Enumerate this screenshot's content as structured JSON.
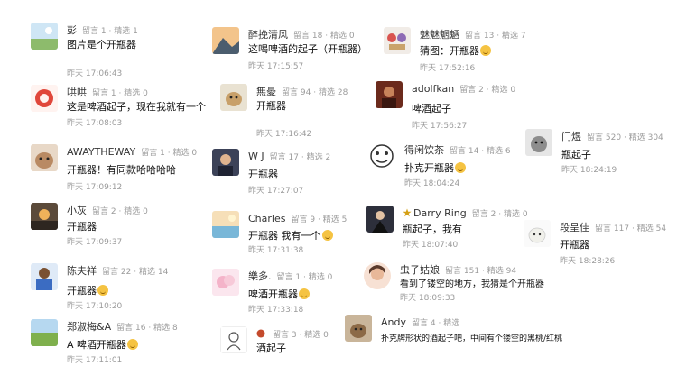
{
  "stat_sep": "·",
  "comments": [
    {
      "id": "c1",
      "nick": "彭",
      "msg_label": "留言",
      "msg_count": "1",
      "pick_label": "精选",
      "pick_count": "1",
      "text": "图片是个开瓶器",
      "emoji": "",
      "time": "昨天 17:06:43",
      "avatar": "landscape"
    },
    {
      "id": "c2",
      "nick": "哄哄",
      "msg_label": "留言",
      "msg_count": "1",
      "pick_label": "精选",
      "pick_count": "0",
      "text": "这是啤酒起子，现在我就有一个",
      "emoji": "",
      "time": "昨天 17:08:03",
      "avatar": "red-circle"
    },
    {
      "id": "c3",
      "nick": "AWAYTHEWAY",
      "msg_label": "留言",
      "msg_count": "1",
      "pick_label": "精选",
      "pick_count": "0",
      "text": "开瓶器！有同款哈哈哈哈",
      "emoji": "",
      "time": "昨天 17:09:12",
      "avatar": "cat"
    },
    {
      "id": "c4",
      "nick": "小灰",
      "msg_label": "留言",
      "msg_count": "2",
      "pick_label": "精选",
      "pick_count": "0",
      "text": "开瓶器",
      "emoji": "",
      "time": "昨天 17:09:37",
      "avatar": "sunset"
    },
    {
      "id": "c5",
      "nick": "陈夫祥",
      "msg_label": "留言",
      "msg_count": "22",
      "pick_label": "精选",
      "pick_count": "14",
      "text": "开瓶器",
      "emoji": "smile",
      "time": "昨天 17:10:20",
      "avatar": "person-blue"
    },
    {
      "id": "c6",
      "nick": "郑淑梅&A",
      "msg_label": "留言",
      "msg_count": "16",
      "pick_label": "精选",
      "pick_count": "8",
      "text": "A 啤酒开瓶器",
      "emoji": "smile",
      "time": "昨天 17:11:01",
      "avatar": "field"
    },
    {
      "id": "c7",
      "nick": "醉挽清风",
      "msg_label": "留言",
      "msg_count": "18",
      "pick_label": "精选",
      "pick_count": "0",
      "text": "这喝啤酒的起子（开瓶器）",
      "emoji": "",
      "time": "昨天 17:15:57",
      "avatar": "mountain"
    },
    {
      "id": "c8",
      "nick": "無憂",
      "msg_label": "留言",
      "msg_count": "94",
      "pick_label": "精选",
      "pick_count": "28",
      "text": "开瓶器",
      "emoji": "",
      "time": "昨天 17:16:42",
      "avatar": "dog"
    },
    {
      "id": "c9",
      "nick": "W J",
      "msg_label": "留言",
      "msg_count": "17",
      "pick_label": "精选",
      "pick_count": "2",
      "text": "开瓶器",
      "emoji": "",
      "time": "昨天 17:27:07",
      "avatar": "boy"
    },
    {
      "id": "c10",
      "nick": "Charles",
      "msg_label": "留言",
      "msg_count": "9",
      "pick_label": "精选",
      "pick_count": "5",
      "text": "开瓶器 我有一个",
      "emoji": "smile",
      "time": "昨天 17:31:38",
      "avatar": "beach"
    },
    {
      "id": "c11",
      "nick": "樂多.",
      "msg_label": "留言",
      "msg_count": "1",
      "pick_label": "精选",
      "pick_count": "0",
      "text": "啤酒开瓶器",
      "emoji": "smile",
      "time": "昨天 17:33:18",
      "avatar": "pink"
    },
    {
      "id": "c12",
      "nick": "",
      "msg_label": "留言",
      "msg_count": "3",
      "pick_label": "精选",
      "pick_count": "0",
      "text": "酒起子",
      "emoji": "",
      "time": "",
      "avatar": "sketch"
    },
    {
      "id": "c13",
      "nick": "魅魅魍魉",
      "msg_label": "留言",
      "msg_count": "13",
      "pick_label": "精选",
      "pick_count": "7",
      "text": "猜图：开瓶器",
      "emoji": "smile",
      "time": "昨天 17:52:16",
      "avatar": "toys"
    },
    {
      "id": "c14",
      "nick": "adolfkan",
      "msg_label": "留言",
      "msg_count": "2",
      "pick_label": "精选",
      "pick_count": "0",
      "text": "啤酒起子",
      "emoji": "",
      "time": "昨天 17:56:27",
      "avatar": "dark-red"
    },
    {
      "id": "c15",
      "nick": "得闲饮茶",
      "msg_label": "留言",
      "msg_count": "14",
      "pick_label": "精选",
      "pick_count": "6",
      "text": "扑克开瓶器",
      "emoji": "smile",
      "time": "昨天 18:04:24",
      "avatar": "meme"
    },
    {
      "id": "c16",
      "nick": "Darry Ring",
      "msg_label": "留言",
      "msg_count": "2",
      "pick_label": "精选",
      "pick_count": "0",
      "text": "瓶起子，我有",
      "emoji": "",
      "time": "昨天 18:07:40",
      "avatar": "suit"
    },
    {
      "id": "c17",
      "nick": "虫子姑娘",
      "msg_label": "留言",
      "msg_count": "151",
      "pick_label": "精选",
      "pick_count": "94",
      "text": "看到了镂空的地方，我猜是个开瓶器",
      "emoji": "",
      "time": "昨天 18:09:33",
      "avatar": "girl"
    },
    {
      "id": "c18",
      "nick": "Andy",
      "msg_label": "留言",
      "msg_count": "4",
      "pick_label": "精选",
      "pick_count": "",
      "text": "扑克牌形状的酒起子吧，中间有个镂空的黑桃/红桃",
      "emoji": "",
      "time": "",
      "avatar": "dog-small"
    },
    {
      "id": "c19",
      "nick": "门煜",
      "msg_label": "留言",
      "msg_count": "520",
      "pick_label": "精选",
      "pick_count": "304",
      "text": "瓶起子",
      "emoji": "",
      "time": "昨天 18:24:19",
      "avatar": "grey-dog"
    },
    {
      "id": "c20",
      "nick": "段呈佳",
      "msg_label": "留言",
      "msg_count": "117",
      "pick_label": "精选",
      "pick_count": "54",
      "text": "开瓶器",
      "emoji": "",
      "time": "昨天 18:28:26",
      "avatar": "white-cat"
    }
  ]
}
